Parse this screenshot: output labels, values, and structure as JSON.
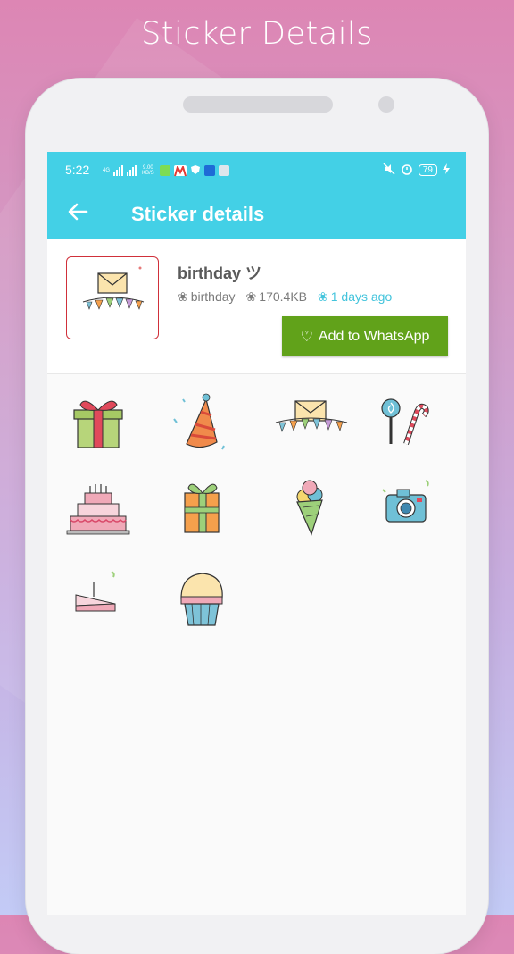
{
  "promo": {
    "title": "Sticker Details"
  },
  "status_bar": {
    "time": "5:22",
    "network_label": "4G",
    "speed_value": "9.00",
    "speed_unit": "KB/S",
    "battery": "79"
  },
  "app_bar": {
    "title": "Sticker details",
    "back_icon": "arrow-left-icon"
  },
  "pack": {
    "name": "birthday ツ",
    "publisher": "birthday",
    "size": "170.4KB",
    "updated": "1 days ago",
    "meta_icon": "flower-icon"
  },
  "add_button": {
    "label": "Add to WhatsApp",
    "icon": "heart-outline-icon"
  },
  "stickers": [
    "gift-box",
    "party-hat",
    "envelope-bunting",
    "lollipop-candy-cane",
    "tiered-cake",
    "gift-stack",
    "ice-cream-cone",
    "camera",
    "cake-slice",
    "cupcake"
  ],
  "colors": {
    "accent": "#43d0e6",
    "button": "#61a21a",
    "tray_border": "#d0303a",
    "days": "#43c4dc"
  }
}
